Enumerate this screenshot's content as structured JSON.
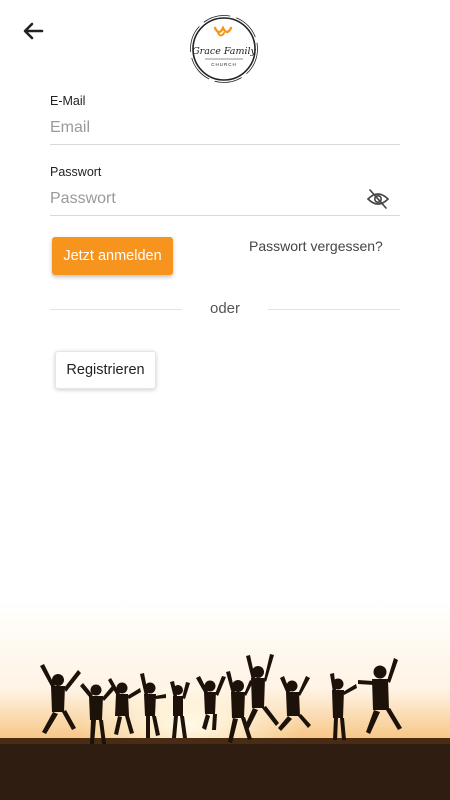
{
  "header": {
    "back_icon": "arrow-left-icon",
    "logo": {
      "line1": "Grace Family",
      "line2": "CHURCH",
      "accent": "#f7941d"
    }
  },
  "form": {
    "email": {
      "label": "E-Mail",
      "placeholder": "Email",
      "value": ""
    },
    "password": {
      "label": "Passwort",
      "placeholder": "Passwort",
      "value": "",
      "toggle_icon": "eye-off-icon"
    },
    "login_button": "Jetzt anmelden",
    "forgot_password": "Passwort vergessen?",
    "divider_text": "oder",
    "register_button": "Registrieren"
  },
  "footer": {
    "image": "people-jumping-at-sunset-silhouette"
  },
  "colors": {
    "primary": "#f7941d",
    "text": "#222222",
    "placeholder": "#9a9a9a"
  }
}
